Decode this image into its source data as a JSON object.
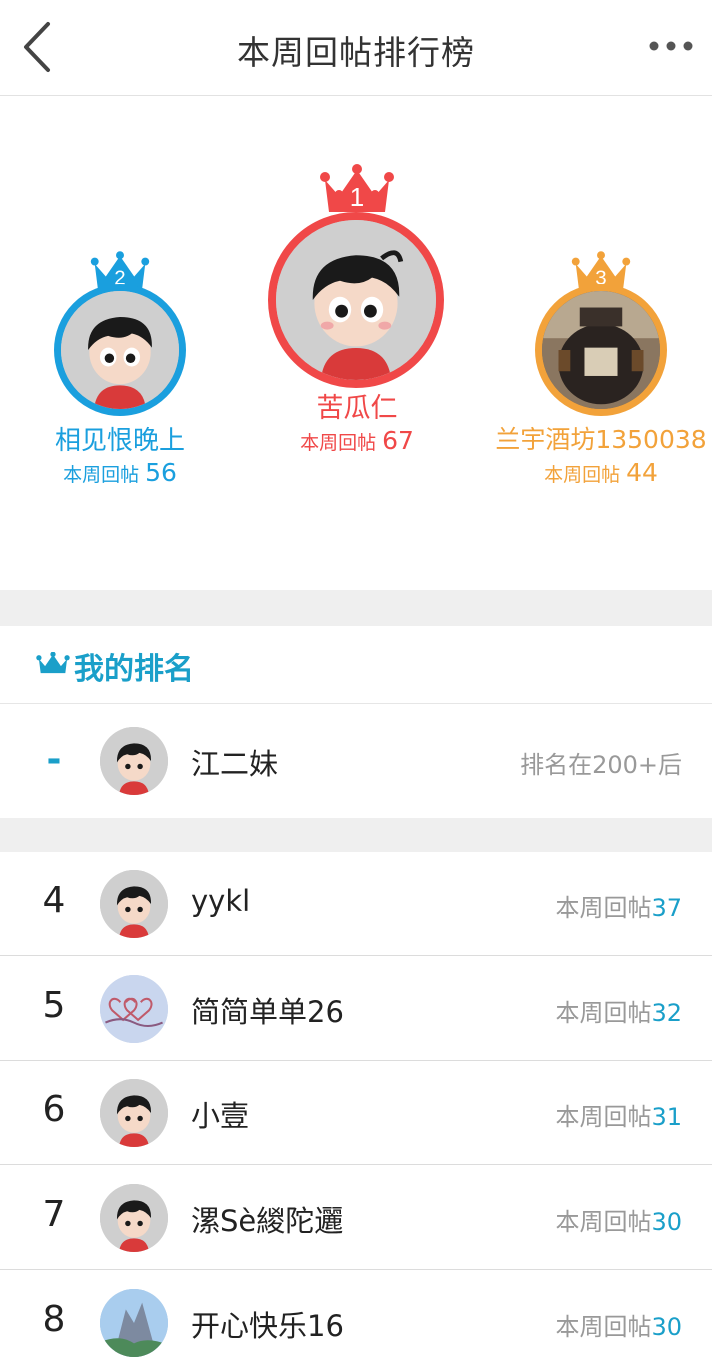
{
  "header": {
    "title": "本周回帖排行榜"
  },
  "top3": [
    {
      "rank": "1",
      "name": "苦瓜仁",
      "count_label": "本周回帖",
      "count": "67",
      "color": "#f04848",
      "avatar": "cartoon-boy"
    },
    {
      "rank": "2",
      "name": "相见恨晚上",
      "count_label": "本周回帖",
      "count": "56",
      "color": "#1a9fde",
      "avatar": "cartoon-boy"
    },
    {
      "rank": "3",
      "name": "兰宇酒坊1350038",
      "count_label": "本周回帖",
      "count": "44",
      "color": "#f2a23a",
      "avatar": "wine-jar-photo"
    }
  ],
  "my_rank": {
    "section_label": "我的排名",
    "rank": "-",
    "name": "江二妹",
    "status": "排名在200+后"
  },
  "list": [
    {
      "rank": "4",
      "name": "yykl",
      "count_label": "本周回帖",
      "count": "37",
      "avatar": "cartoon-boy"
    },
    {
      "rank": "5",
      "name": "简简单单26",
      "count_label": "本周回帖",
      "count": "32",
      "avatar": "hearts-photo"
    },
    {
      "rank": "6",
      "name": "小壹",
      "count_label": "本周回帖",
      "count": "31",
      "avatar": "cartoon-boy"
    },
    {
      "rank": "7",
      "name": "漯Sè緵陀邐",
      "count_label": "本周回帖",
      "count": "30",
      "avatar": "cartoon-boy"
    },
    {
      "rank": "8",
      "name": "开心快乐16",
      "count_label": "本周回帖",
      "count": "30",
      "avatar": "landscape-photo"
    }
  ],
  "colors": {
    "accent": "#1a9fc9",
    "gold": "#f04848",
    "silver": "#1a9fde",
    "bronze": "#f2a23a",
    "divider": "#efefef"
  }
}
